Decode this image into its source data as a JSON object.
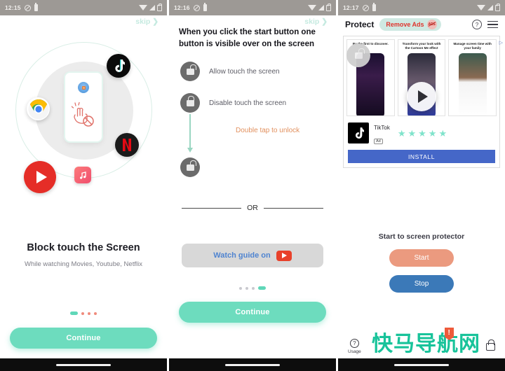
{
  "panels": [
    {
      "status": {
        "time": "12:15",
        "icons": [
          "dnd-icon",
          "battery-icon",
          "wifi-icon",
          "signal-icon",
          "lock-icon"
        ]
      },
      "skip_label": "skip ❯",
      "illustration": {
        "apps": [
          "tiktok-icon",
          "chrome-icon",
          "netflix-icon",
          "youtube-icon",
          "music-icon"
        ],
        "phone_badges": [
          "lock-icon",
          "no-touch-hand-icon"
        ]
      },
      "title": "Block touch the Screen",
      "subtitle": "While watching Movies, Youtube, Netflix",
      "dots": [
        "active",
        "red",
        "red",
        "red"
      ],
      "cta_label": "Continue"
    },
    {
      "status": {
        "time": "12:16"
      },
      "skip_label": "skip ❯",
      "heading": "When you click the start button one button is visible over on the screen",
      "rows": [
        {
          "icon": "unlock-icon",
          "label": "Allow touch the screen"
        },
        {
          "icon": "lock-icon",
          "label": "Disable touch the screen"
        }
      ],
      "arrow_note": "Double tap to unlock",
      "final_icon": "unlock-icon",
      "divider_label": "OR",
      "watch_label": "Watch guide on",
      "watch_icon": "youtube-icon",
      "dots": [
        "gray",
        "gray",
        "gray",
        "active"
      ],
      "cta_label": "Continue"
    },
    {
      "status": {
        "time": "12:17"
      },
      "appbar": {
        "title": "Protect",
        "remove_ads_label": "Remove Ads",
        "remove_ads_badge": "ADS",
        "help_icon": "help-icon",
        "menu_icon": "hamburger-menu-icon"
      },
      "ad": {
        "captions": [
          "Be the first to discover.",
          "Transform your look with the Cartoon Me effect",
          "Manage screen time with your family"
        ],
        "play_icon": "play-button-icon",
        "app_name": "TikTok",
        "app_logo": "tiktok-icon",
        "ad_badge": "Ad",
        "stars": 5,
        "star_color": "#7fe3cb",
        "install_label": "INSTALL",
        "choices_icon": "adchoices-icon"
      },
      "section_title": "Start to screen protector",
      "buttons": [
        {
          "label": "Start",
          "color": "#eb9a7f"
        },
        {
          "label": "Stop",
          "color": "#3b79b8"
        }
      ],
      "bottom_nav": [
        {
          "icon": "usage-help-icon",
          "label": "Usage"
        },
        {
          "icon": "lock-icon",
          "label": ""
        }
      ],
      "watermark": "快马导航网"
    }
  ],
  "colors": {
    "accent_teal": "#6ddcbe",
    "salmon": "#eb9a7f",
    "blue": "#3b79b8",
    "install_blue": "#4567c8",
    "statusbar": "#9d9995"
  }
}
